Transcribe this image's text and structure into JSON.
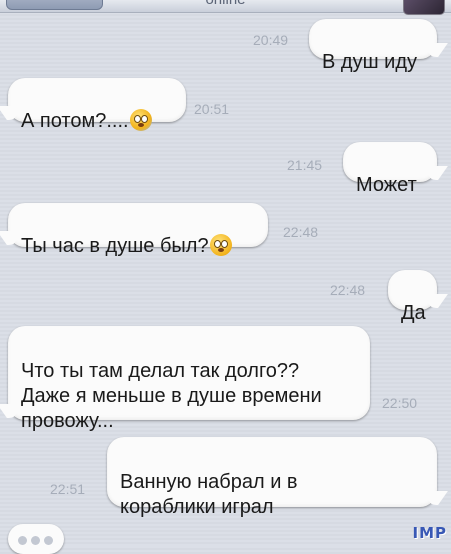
{
  "header": {
    "status": "online"
  },
  "messages": [
    {
      "side": "out",
      "text": "В душ иду",
      "time": "20:49"
    },
    {
      "side": "in",
      "text": "А потом?....",
      "emoji": "fearful-face-emoji",
      "time": "20:51"
    },
    {
      "side": "out",
      "text": "Может",
      "time": "21:45"
    },
    {
      "side": "in",
      "text": "Ты час в душе был?",
      "emoji": "flushed-face-emoji",
      "time": "22:48"
    },
    {
      "side": "out",
      "text": "Да",
      "time": "22:48"
    },
    {
      "side": "in",
      "text": "Что ты там делал так долго??\nДаже я меньше в душе времени\nпровожу...",
      "time": "22:50"
    },
    {
      "side": "out",
      "text": "Ванную набрал и в\nкораблики играл",
      "time": "22:51"
    }
  ],
  "watermark": "IMP",
  "colors": {
    "background": "#d9dde6",
    "bubble": "#fbfbfb",
    "timestamp": "#a6adb9"
  }
}
